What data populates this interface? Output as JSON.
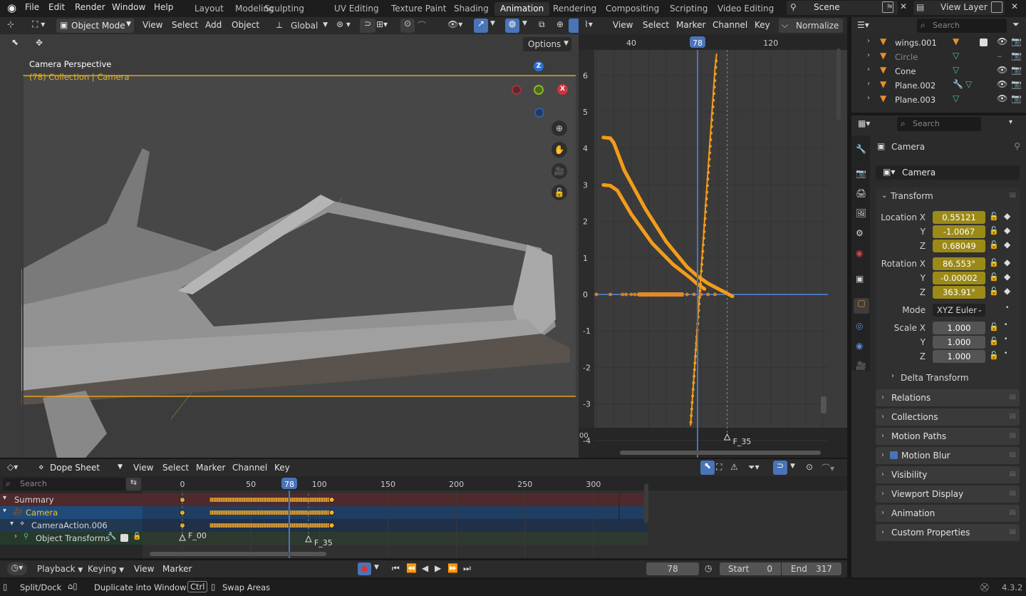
{
  "menu": {
    "file": "File",
    "edit": "Edit",
    "render": "Render",
    "window": "Window",
    "help": "Help"
  },
  "workspaces": [
    "Layout",
    "Modeling",
    "Sculpting",
    "UV Editing",
    "Texture Paint",
    "Shading",
    "Animation",
    "Rendering",
    "Compositing",
    "Scripting",
    "Video Editing"
  ],
  "active_workspace": "Animation",
  "scene": "Scene",
  "view_layer": "View Layer",
  "viewport": {
    "mode": "Object Mode",
    "menus": [
      "View",
      "Select",
      "Add",
      "Object"
    ],
    "orientation": "Global",
    "options": "Options",
    "overlay_title": "Camera Perspective",
    "overlay_sub": "(78) Collection | Camera",
    "gizmo": {
      "z": "Z",
      "x": "X"
    }
  },
  "graph": {
    "menus": [
      "View",
      "Select",
      "Marker",
      "Channel",
      "Key"
    ],
    "normalize": "Normalize",
    "frame_ticks": [
      "40",
      "78",
      "120"
    ],
    "y_ticks": [
      "6",
      "5",
      "4",
      "3",
      "2",
      "1",
      "0",
      "-1",
      "-2",
      "-3",
      "-4"
    ],
    "marker": "F_35",
    "corner": "00"
  },
  "outliner": {
    "search": "Search",
    "items": [
      {
        "name": "wings.001"
      },
      {
        "name": "Circle"
      },
      {
        "name": "Cone"
      },
      {
        "name": "Plane.002"
      },
      {
        "name": "Plane.003"
      }
    ]
  },
  "props": {
    "search": "Search",
    "object_name": "Camera",
    "data_name": "Camera",
    "transform": "Transform",
    "location": {
      "label": "Location X",
      "x": "0.55121",
      "y": "-1.0067",
      "z": "0.68049"
    },
    "rotation": {
      "label": "Rotation X",
      "x": "86.553°",
      "y": "-0.00002",
      "z": "363.91°"
    },
    "mode_label": "Mode",
    "mode_value": "XYZ Euler",
    "scale": {
      "label": "Scale X",
      "x": "1.000",
      "y": "1.000",
      "z": "1.000"
    },
    "axis_y": "Y",
    "axis_z": "Z",
    "delta": "Delta Transform",
    "sections": [
      "Relations",
      "Collections",
      "Motion Paths",
      "Motion Blur",
      "Visibility",
      "Viewport Display",
      "Animation",
      "Custom Properties"
    ]
  },
  "dopesheet": {
    "mode": "Dope Sheet",
    "menus": [
      "View",
      "Select",
      "Marker",
      "Channel",
      "Key"
    ],
    "search": "Search",
    "ticks": [
      "0",
      "50",
      "78",
      "100",
      "150",
      "200",
      "250",
      "300"
    ],
    "channels": [
      "Summary",
      "Camera",
      "CameraAction.006",
      "Object Transforms"
    ],
    "markers": [
      "F_00",
      "F_35"
    ]
  },
  "timeline": {
    "menus": [
      "Playback",
      "Keying",
      "View",
      "Marker"
    ],
    "frame": "78",
    "start_label": "Start",
    "start": "0",
    "end_label": "End",
    "end": "317"
  },
  "status": {
    "split": "Split/Dock",
    "duplicate": "Duplicate into Window",
    "ctrl": "Ctrl",
    "swap": "Swap Areas",
    "version": "4.3.2"
  }
}
